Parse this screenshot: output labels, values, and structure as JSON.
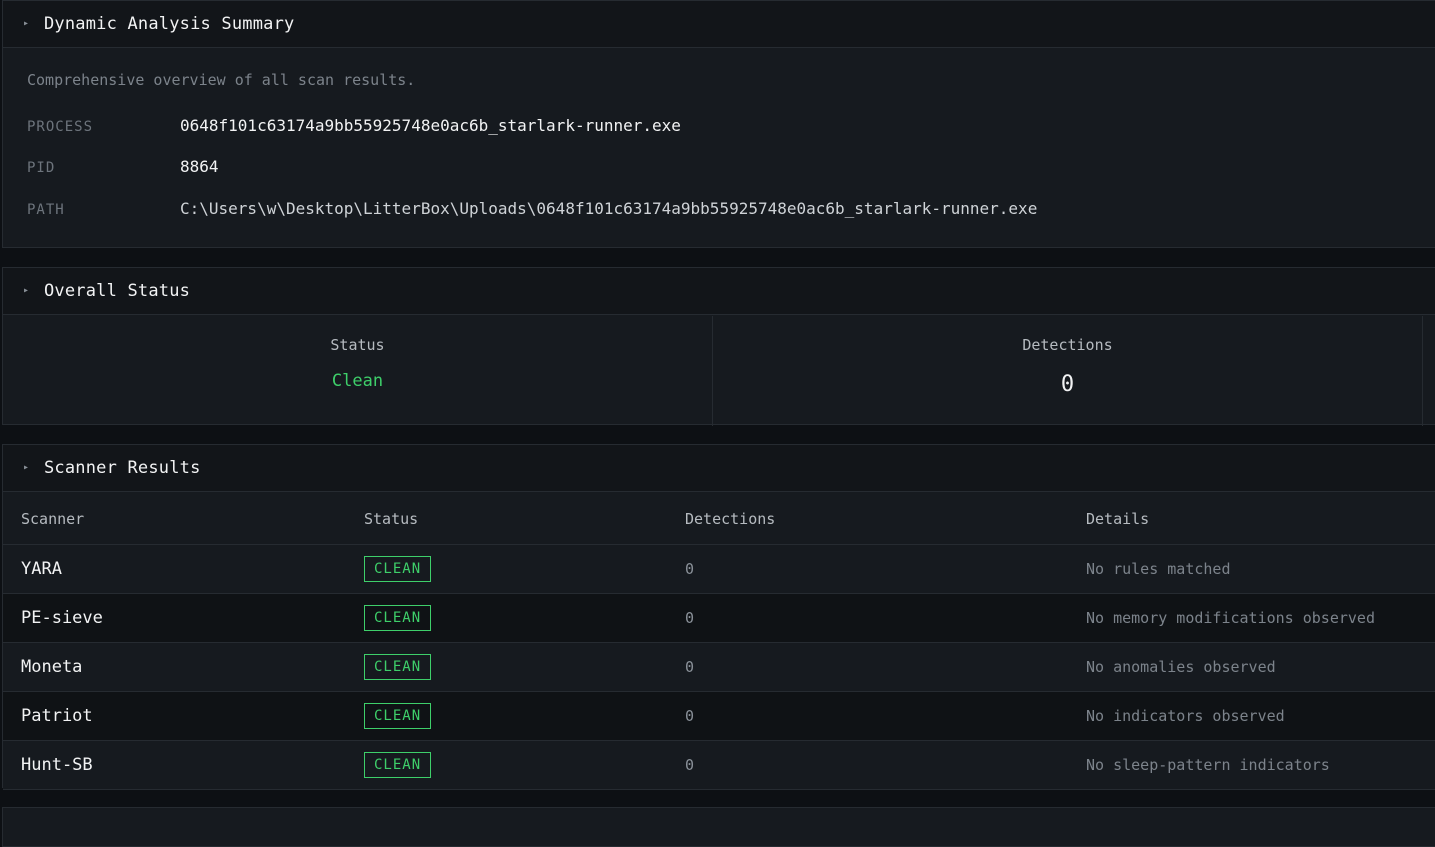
{
  "summary": {
    "title": "Dynamic Analysis Summary",
    "description": "Comprehensive overview of all scan results.",
    "fields": [
      {
        "key": "PROCESS",
        "value": "0648f101c63174a9bb55925748e0ac6b_starlark-runner.exe"
      },
      {
        "key": "PID",
        "value": "8864"
      },
      {
        "key": "PATH",
        "value": "C:\\Users\\w\\Desktop\\LitterBox\\Uploads\\0648f101c63174a9bb55925748e0ac6b_starlark-runner.exe"
      }
    ]
  },
  "overall": {
    "title": "Overall Status",
    "status_label": "Status",
    "status_value": "Clean",
    "detections_label": "Detections",
    "detections_value": "0"
  },
  "scanner": {
    "title": "Scanner Results",
    "columns": [
      "Scanner",
      "Status",
      "Detections",
      "Details"
    ],
    "rows": [
      {
        "name": "YARA",
        "status": "CLEAN",
        "detections": "0",
        "details": "No rules matched"
      },
      {
        "name": "PE-sieve",
        "status": "CLEAN",
        "detections": "0",
        "details": "No memory modifications observed"
      },
      {
        "name": "Moneta",
        "status": "CLEAN",
        "detections": "0",
        "details": "No anomalies observed"
      },
      {
        "name": "Patriot",
        "status": "CLEAN",
        "detections": "0",
        "details": "No indicators observed"
      },
      {
        "name": "Hunt-SB",
        "status": "CLEAN",
        "detections": "0",
        "details": "No sleep-pattern indicators"
      }
    ]
  },
  "colors": {
    "accent_green": "#3ecf6a",
    "background": "#0d1014",
    "panel": "#161a1f"
  },
  "icons": {
    "section_caret": "caret-right-icon"
  }
}
